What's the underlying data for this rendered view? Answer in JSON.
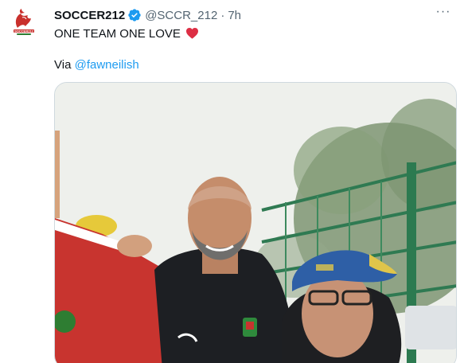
{
  "tweet": {
    "display_name": "SOCCER212",
    "handle": "@SCCR_212",
    "separator": "·",
    "time": "7h",
    "text": "ONE TEAM ONE LOVE",
    "via_label": "Via",
    "via_link": "@fawneilish",
    "more_label": "···",
    "avatar_text": "SOCCER212"
  },
  "colors": {
    "link": "#1d9bf0",
    "verified": "#1d9bf0",
    "heart": "#e0245e",
    "secondary_text": "#536471"
  },
  "icons": {
    "verified": "verified-badge-icon",
    "heart": "red-heart-emoji",
    "more": "more-options-icon"
  }
}
